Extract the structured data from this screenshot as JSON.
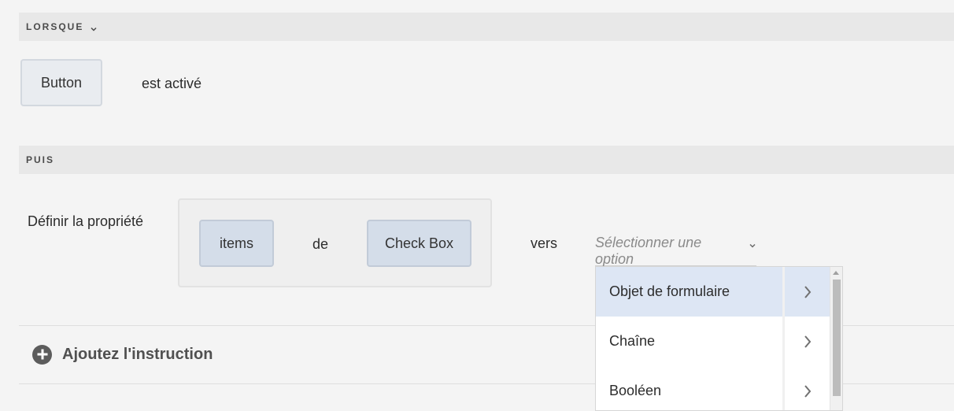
{
  "when_section": {
    "title": "LORSQUE"
  },
  "trigger": {
    "component": "Button",
    "event": "est activé"
  },
  "then_section": {
    "title": "PUIS"
  },
  "action": {
    "label": "Définir la propriété",
    "property": "items",
    "connector": "de",
    "object": "Check Box",
    "to_label": "vers",
    "select_placeholder": "Sélectionner une option"
  },
  "add_instruction": {
    "label": "Ajoutez l'instruction"
  },
  "dropdown": {
    "items": [
      {
        "label": "Objet de formulaire",
        "selected": true
      },
      {
        "label": "Chaîne",
        "selected": false
      },
      {
        "label": "Booléen",
        "selected": false
      }
    ]
  },
  "colors": {
    "selected_item": "#dde6f4",
    "token_blue": "#d4dde9",
    "section_header": "#e8e8e8"
  }
}
